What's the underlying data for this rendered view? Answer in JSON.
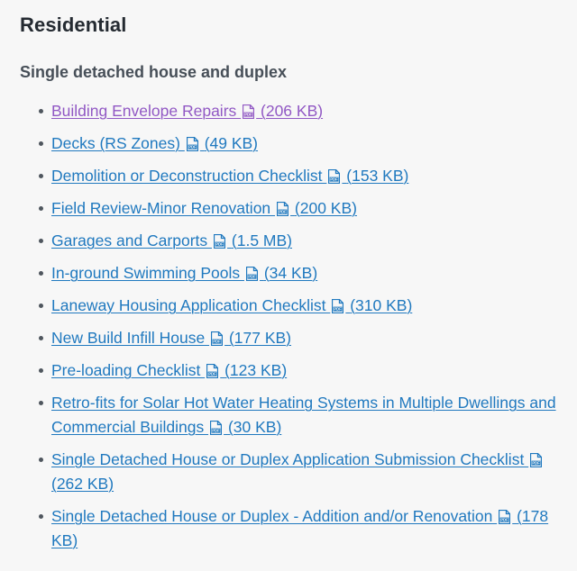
{
  "page": {
    "title": "Residential",
    "subtitle": "Single detached house and duplex",
    "background_color": "#f7f7f7",
    "title_color": "#242a31",
    "subtitle_color": "#474f58"
  },
  "colors": {
    "link": "#2079bf",
    "visited_link": "#9158c4",
    "bullet": "#4f565e"
  },
  "documents": {
    "icon_name": "pdf-icon",
    "items": [
      {
        "label": "Building Envelope Repairs",
        "size": "(206 KB)",
        "visited": true
      },
      {
        "label": "Decks (RS Zones)",
        "size": "(49 KB)",
        "visited": false
      },
      {
        "label": "Demolition or Deconstruction Checklist",
        "size": "(153 KB)",
        "visited": false
      },
      {
        "label": "Field Review-Minor Renovation",
        "size": "(200 KB)",
        "visited": false
      },
      {
        "label": "Garages and Carports",
        "size": "(1.5 MB)",
        "visited": false
      },
      {
        "label": "In-ground Swimming Pools",
        "size": "(34 KB)",
        "visited": false
      },
      {
        "label": "Laneway Housing Application Checklist",
        "size": "(310 KB)",
        "visited": false
      },
      {
        "label": "New Build Infill House",
        "size": "(177 KB)",
        "visited": false
      },
      {
        "label": "Pre-loading Checklist",
        "size": "(123 KB)",
        "visited": false
      },
      {
        "label": "Retro-fits for Solar Hot Water Heating Systems in Multiple Dwellings and Commercial Buildings",
        "size": "(30 KB)",
        "visited": false
      },
      {
        "label": "Single Detached House or Duplex Application Submission Checklist",
        "size": "(262 KB)",
        "visited": false
      },
      {
        "label": "Single Detached House or Duplex - Addition and/or Renovation",
        "size": "(178 KB)",
        "visited": false
      }
    ]
  }
}
